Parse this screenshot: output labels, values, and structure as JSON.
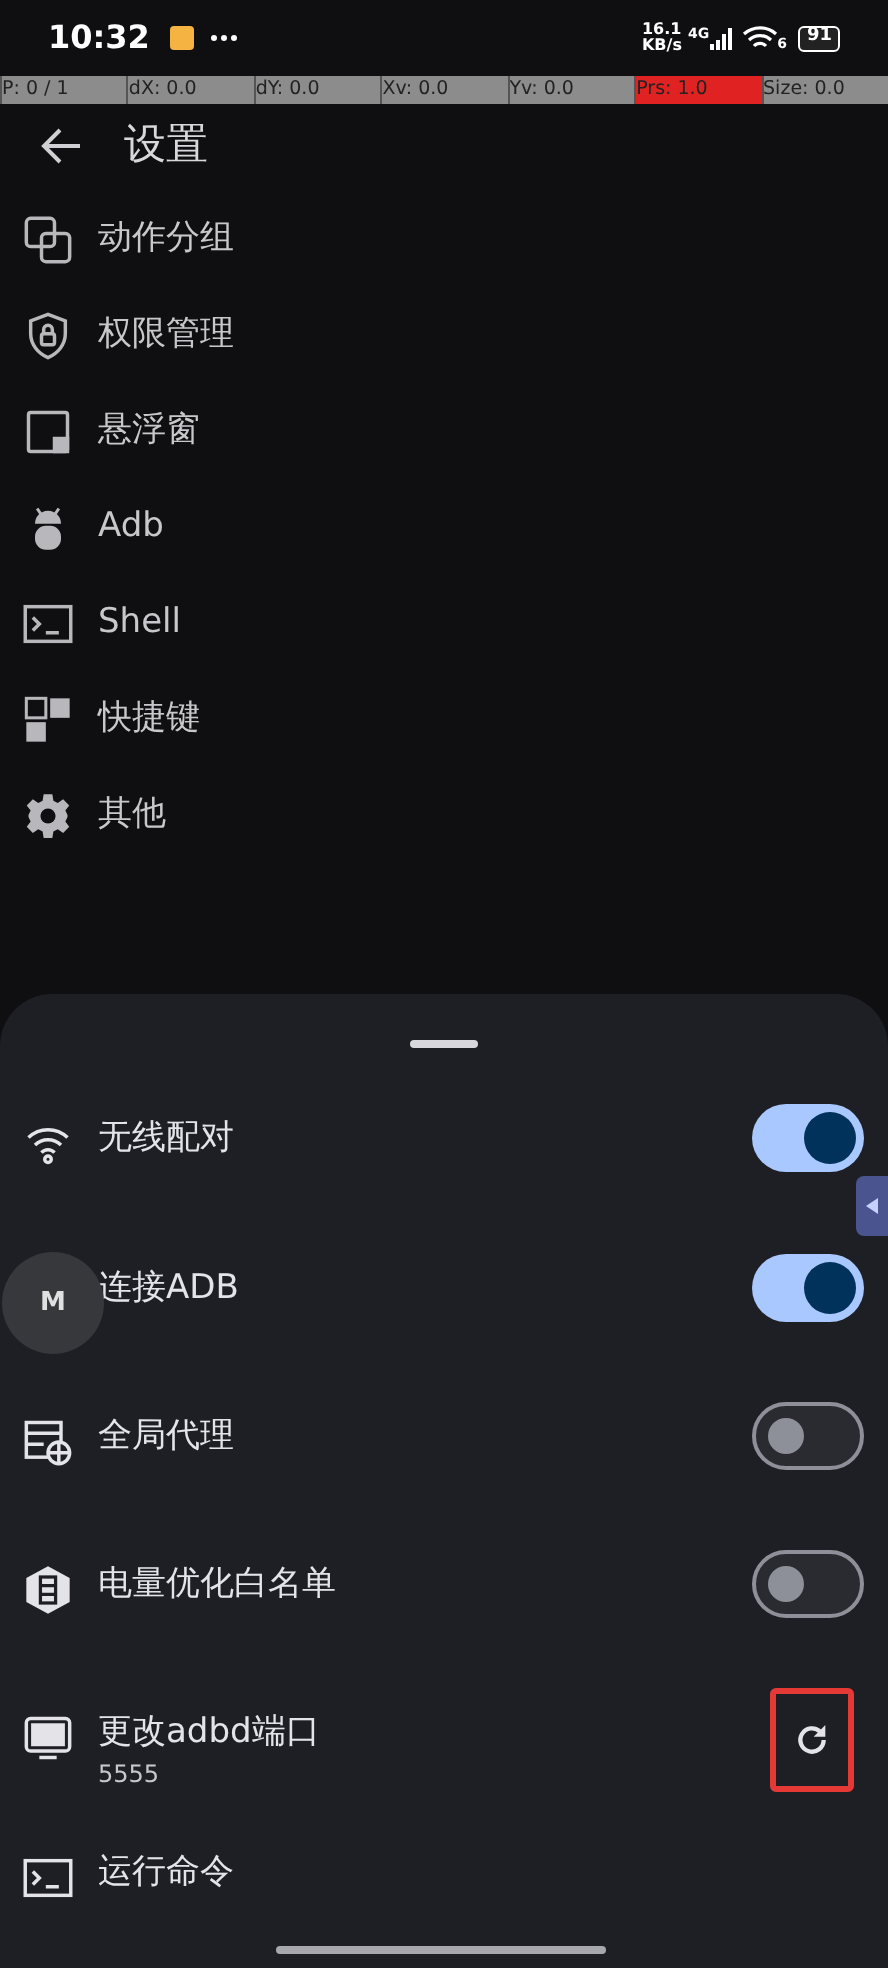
{
  "status_bar": {
    "time": "10:32",
    "speed_value": "16.1",
    "speed_unit": "KB/s",
    "network": "4G",
    "wifi_band": "6",
    "battery": "91"
  },
  "pointer_bar": [
    {
      "text": "P: 0 / 1",
      "active": false
    },
    {
      "text": "dX: 0.0",
      "active": false
    },
    {
      "text": "dY: 0.0",
      "active": false
    },
    {
      "text": "Xv: 0.0",
      "active": false
    },
    {
      "text": "Yv: 0.0",
      "active": false
    },
    {
      "text": "Prs: 1.0",
      "active": true
    },
    {
      "text": "Size: 0.0",
      "active": false
    }
  ],
  "header": {
    "title": "设置"
  },
  "menu": [
    {
      "label": "动作分组"
    },
    {
      "label": "权限管理"
    },
    {
      "label": "悬浮窗"
    },
    {
      "label": "Adb"
    },
    {
      "label": "Shell"
    },
    {
      "label": "快捷键"
    },
    {
      "label": "其他"
    }
  ],
  "sheet": {
    "items": [
      {
        "kind": "toggle",
        "label": "无线配对",
        "on": true
      },
      {
        "kind": "toggle",
        "label": "连接ADB",
        "on": true
      },
      {
        "kind": "toggle",
        "label": "全局代理",
        "on": false
      },
      {
        "kind": "toggle",
        "label": "电量优化白名单",
        "on": false
      },
      {
        "kind": "action",
        "label": "更改adbd端口",
        "subtitle": "5555",
        "highlighted": true
      },
      {
        "kind": "plain",
        "label": "运行命令"
      }
    ]
  },
  "floating_button": {
    "label": "M"
  }
}
